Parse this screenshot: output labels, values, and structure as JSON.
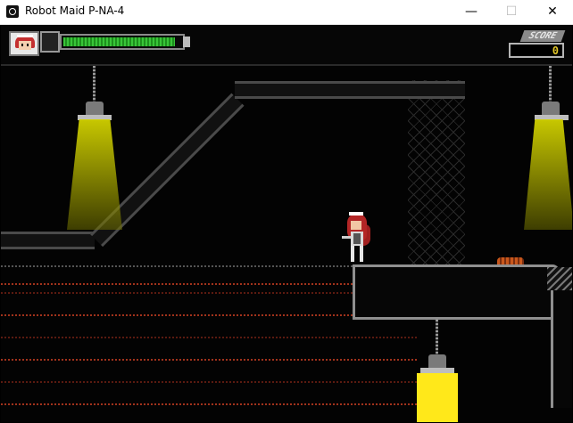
{
  "window": {
    "title": "Robot Maid P-NA-4",
    "controls": {
      "minimize": "—",
      "maximize": "☐",
      "close": "✕"
    }
  },
  "hud": {
    "health_fraction": 0.95,
    "score_label": "SCORE",
    "score_value": "0"
  },
  "colors": {
    "health_green": "#39c539",
    "lamp_yellow": "#ffe81a",
    "score_yellow": "#e3c72a",
    "floor_red": "#a0321c"
  },
  "icons": {
    "app": "robot-maid-app-icon",
    "portrait": "maid-portrait-icon"
  }
}
